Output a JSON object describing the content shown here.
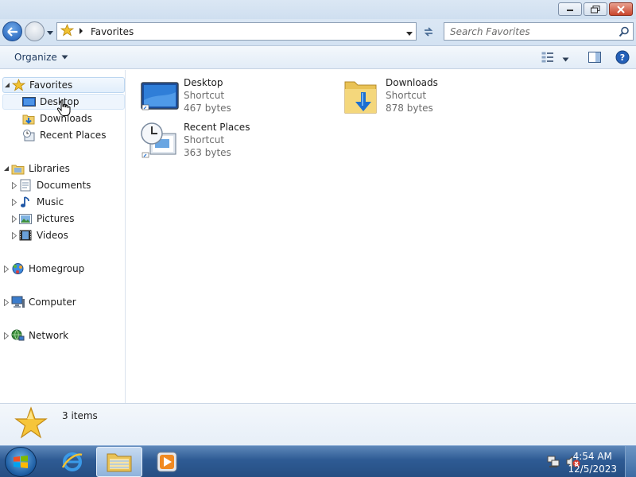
{
  "window": {
    "controls": {
      "minimize": "minimize-icon",
      "maximize": "restore-icon",
      "close": "close-icon"
    }
  },
  "navigation": {
    "address_crumb": "Favorites",
    "search_placeholder": "Search Favorites"
  },
  "toolbar": {
    "organize_label": "Organize"
  },
  "tree": {
    "favorites": {
      "label": "Favorites",
      "children": [
        {
          "label": "Desktop"
        },
        {
          "label": "Downloads"
        },
        {
          "label": "Recent Places"
        }
      ]
    },
    "libraries": {
      "label": "Libraries",
      "children": [
        {
          "label": "Documents"
        },
        {
          "label": "Music"
        },
        {
          "label": "Pictures"
        },
        {
          "label": "Videos"
        }
      ]
    },
    "homegroup": {
      "label": "Homegroup"
    },
    "computer": {
      "label": "Computer"
    },
    "network": {
      "label": "Network"
    }
  },
  "items": [
    {
      "name": "Desktop",
      "type": "Shortcut",
      "size": "467 bytes",
      "icon": "desktop-icon"
    },
    {
      "name": "Downloads",
      "type": "Shortcut",
      "size": "878 bytes",
      "icon": "downloads-folder-icon"
    },
    {
      "name": "Recent Places",
      "type": "Shortcut",
      "size": "363 bytes",
      "icon": "recent-places-icon"
    }
  ],
  "details": {
    "item_count": "3 items"
  },
  "taskbar": {
    "time": "4:54 AM",
    "date": "12/5/2023"
  },
  "colors": {
    "accent": "#3a6fb0",
    "selection": "#e1eefb",
    "taskbar": "#2e5b94"
  }
}
